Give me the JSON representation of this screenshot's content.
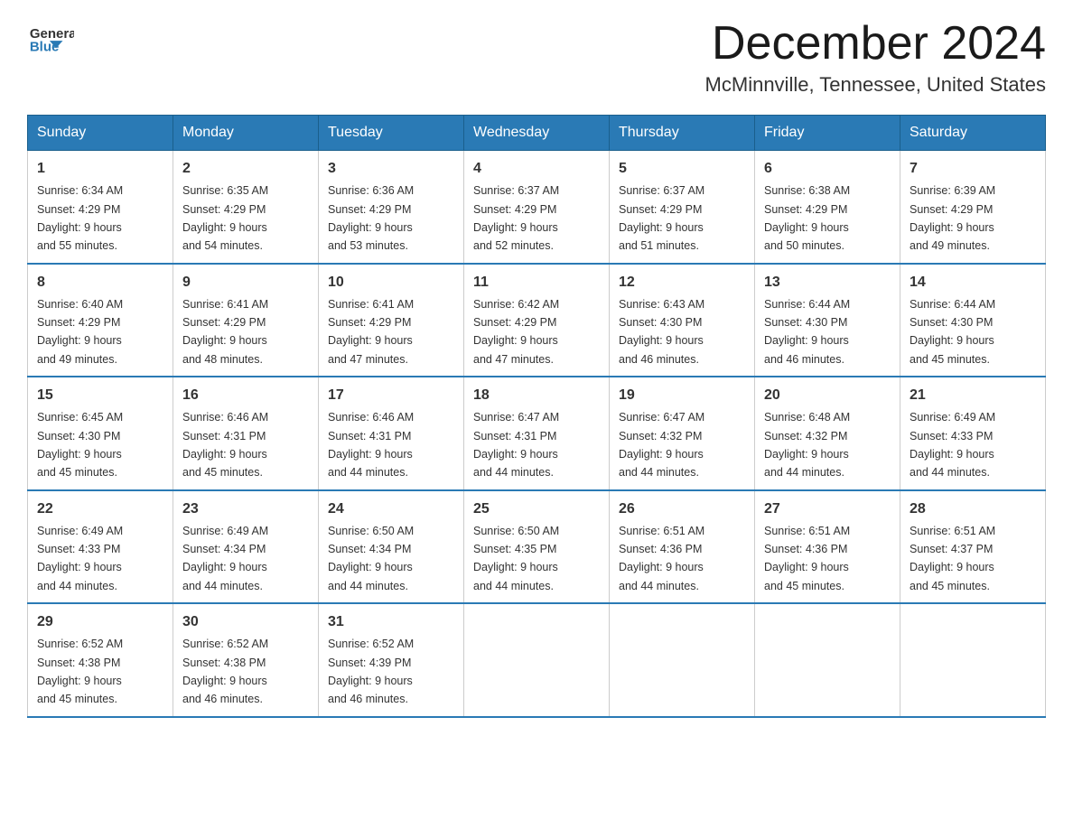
{
  "header": {
    "logo_general": "General",
    "logo_blue": "Blue",
    "month_year": "December 2024",
    "location": "McMinnville, Tennessee, United States"
  },
  "days_of_week": [
    "Sunday",
    "Monday",
    "Tuesday",
    "Wednesday",
    "Thursday",
    "Friday",
    "Saturday"
  ],
  "weeks": [
    [
      {
        "day": "1",
        "sunrise": "6:34 AM",
        "sunset": "4:29 PM",
        "daylight": "9 hours and 55 minutes."
      },
      {
        "day": "2",
        "sunrise": "6:35 AM",
        "sunset": "4:29 PM",
        "daylight": "9 hours and 54 minutes."
      },
      {
        "day": "3",
        "sunrise": "6:36 AM",
        "sunset": "4:29 PM",
        "daylight": "9 hours and 53 minutes."
      },
      {
        "day": "4",
        "sunrise": "6:37 AM",
        "sunset": "4:29 PM",
        "daylight": "9 hours and 52 minutes."
      },
      {
        "day": "5",
        "sunrise": "6:37 AM",
        "sunset": "4:29 PM",
        "daylight": "9 hours and 51 minutes."
      },
      {
        "day": "6",
        "sunrise": "6:38 AM",
        "sunset": "4:29 PM",
        "daylight": "9 hours and 50 minutes."
      },
      {
        "day": "7",
        "sunrise": "6:39 AM",
        "sunset": "4:29 PM",
        "daylight": "9 hours and 49 minutes."
      }
    ],
    [
      {
        "day": "8",
        "sunrise": "6:40 AM",
        "sunset": "4:29 PM",
        "daylight": "9 hours and 49 minutes."
      },
      {
        "day": "9",
        "sunrise": "6:41 AM",
        "sunset": "4:29 PM",
        "daylight": "9 hours and 48 minutes."
      },
      {
        "day": "10",
        "sunrise": "6:41 AM",
        "sunset": "4:29 PM",
        "daylight": "9 hours and 47 minutes."
      },
      {
        "day": "11",
        "sunrise": "6:42 AM",
        "sunset": "4:29 PM",
        "daylight": "9 hours and 47 minutes."
      },
      {
        "day": "12",
        "sunrise": "6:43 AM",
        "sunset": "4:30 PM",
        "daylight": "9 hours and 46 minutes."
      },
      {
        "day": "13",
        "sunrise": "6:44 AM",
        "sunset": "4:30 PM",
        "daylight": "9 hours and 46 minutes."
      },
      {
        "day": "14",
        "sunrise": "6:44 AM",
        "sunset": "4:30 PM",
        "daylight": "9 hours and 45 minutes."
      }
    ],
    [
      {
        "day": "15",
        "sunrise": "6:45 AM",
        "sunset": "4:30 PM",
        "daylight": "9 hours and 45 minutes."
      },
      {
        "day": "16",
        "sunrise": "6:46 AM",
        "sunset": "4:31 PM",
        "daylight": "9 hours and 45 minutes."
      },
      {
        "day": "17",
        "sunrise": "6:46 AM",
        "sunset": "4:31 PM",
        "daylight": "9 hours and 44 minutes."
      },
      {
        "day": "18",
        "sunrise": "6:47 AM",
        "sunset": "4:31 PM",
        "daylight": "9 hours and 44 minutes."
      },
      {
        "day": "19",
        "sunrise": "6:47 AM",
        "sunset": "4:32 PM",
        "daylight": "9 hours and 44 minutes."
      },
      {
        "day": "20",
        "sunrise": "6:48 AM",
        "sunset": "4:32 PM",
        "daylight": "9 hours and 44 minutes."
      },
      {
        "day": "21",
        "sunrise": "6:49 AM",
        "sunset": "4:33 PM",
        "daylight": "9 hours and 44 minutes."
      }
    ],
    [
      {
        "day": "22",
        "sunrise": "6:49 AM",
        "sunset": "4:33 PM",
        "daylight": "9 hours and 44 minutes."
      },
      {
        "day": "23",
        "sunrise": "6:49 AM",
        "sunset": "4:34 PM",
        "daylight": "9 hours and 44 minutes."
      },
      {
        "day": "24",
        "sunrise": "6:50 AM",
        "sunset": "4:34 PM",
        "daylight": "9 hours and 44 minutes."
      },
      {
        "day": "25",
        "sunrise": "6:50 AM",
        "sunset": "4:35 PM",
        "daylight": "9 hours and 44 minutes."
      },
      {
        "day": "26",
        "sunrise": "6:51 AM",
        "sunset": "4:36 PM",
        "daylight": "9 hours and 44 minutes."
      },
      {
        "day": "27",
        "sunrise": "6:51 AM",
        "sunset": "4:36 PM",
        "daylight": "9 hours and 45 minutes."
      },
      {
        "day": "28",
        "sunrise": "6:51 AM",
        "sunset": "4:37 PM",
        "daylight": "9 hours and 45 minutes."
      }
    ],
    [
      {
        "day": "29",
        "sunrise": "6:52 AM",
        "sunset": "4:38 PM",
        "daylight": "9 hours and 45 minutes."
      },
      {
        "day": "30",
        "sunrise": "6:52 AM",
        "sunset": "4:38 PM",
        "daylight": "9 hours and 46 minutes."
      },
      {
        "day": "31",
        "sunrise": "6:52 AM",
        "sunset": "4:39 PM",
        "daylight": "9 hours and 46 minutes."
      },
      null,
      null,
      null,
      null
    ]
  ],
  "labels": {
    "sunrise": "Sunrise:",
    "sunset": "Sunset:",
    "daylight": "Daylight: 9 hours"
  }
}
